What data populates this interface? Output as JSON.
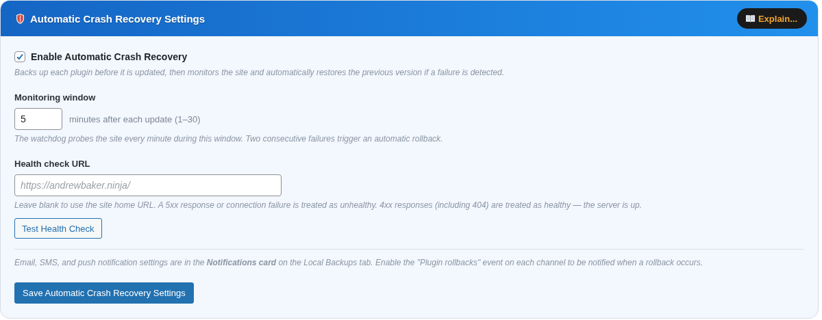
{
  "header": {
    "title": "Automatic Crash Recovery Settings",
    "explain_button": "Explain..."
  },
  "enable": {
    "label": "Enable Automatic Crash Recovery",
    "checked": true,
    "description": "Backs up each plugin before it is updated, then monitors the site and automatically restores the previous version if a failure is detected."
  },
  "monitoring": {
    "label": "Monitoring window",
    "value": "5",
    "suffix": "minutes after each update (1–30)",
    "description": "The watchdog probes the site every minute during this window. Two consecutive failures trigger an automatic rollback."
  },
  "health": {
    "label": "Health check URL",
    "placeholder": "https://andrewbaker.ninja/",
    "description": "Leave blank to use the site home URL. A 5xx response or connection failure is treated as unhealthy. 4xx responses (including 404) are treated as healthy — the server is up.",
    "test_button": "Test Health Check"
  },
  "note": "Email, SMS, and push notification settings are in the **Notifications card** on the Local Backups tab. Enable the \"Plugin rollbacks\" event on each channel to be notified when a rollback occurs.",
  "save_button": "Save Automatic Crash Recovery Settings"
}
